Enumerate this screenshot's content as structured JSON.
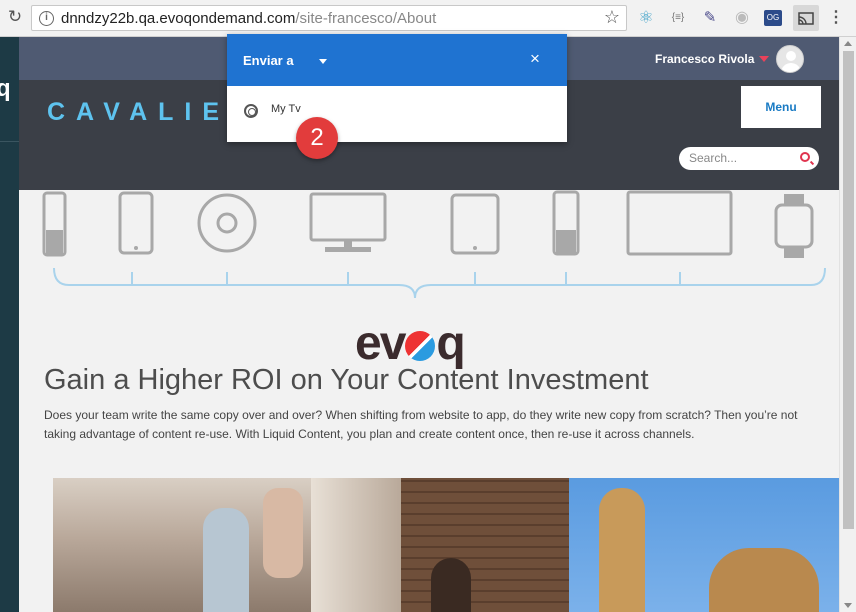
{
  "browser": {
    "url_host": "dnndzy22b.qa.evoqondemand.com",
    "url_path": "/site-francesco/About",
    "extensions": {
      "json_label": "{≡}",
      "og_label": "OG"
    }
  },
  "left_strip": {
    "fragment": "q"
  },
  "user": {
    "name": "Francesco Rivola"
  },
  "header": {
    "logo": "CAVALIE",
    "menu_label": "Menu"
  },
  "search": {
    "placeholder": "Search..."
  },
  "main": {
    "logo": {
      "pre": "ev",
      "post": "q"
    },
    "headline": "Gain a Higher ROI on Your Content Investment",
    "intro": "Does your team write the same copy over and over? When shifting from website to app, do they write new copy from scratch? Then you’re not taking advantage of content re-use. With Liquid Content, you plan and create content once, then re-use it across channels."
  },
  "cast_popup": {
    "title": "Enviar a",
    "close": "×",
    "devices": [
      {
        "name": "My Tv"
      }
    ]
  },
  "callout": {
    "step": "2"
  },
  "colors": {
    "cast_blue": "#1f73d1",
    "header_dark": "#3b3f47",
    "topbar": "#4f5a72",
    "logo_cyan": "#5ec3ef",
    "accent_red": "#e23c3c"
  }
}
